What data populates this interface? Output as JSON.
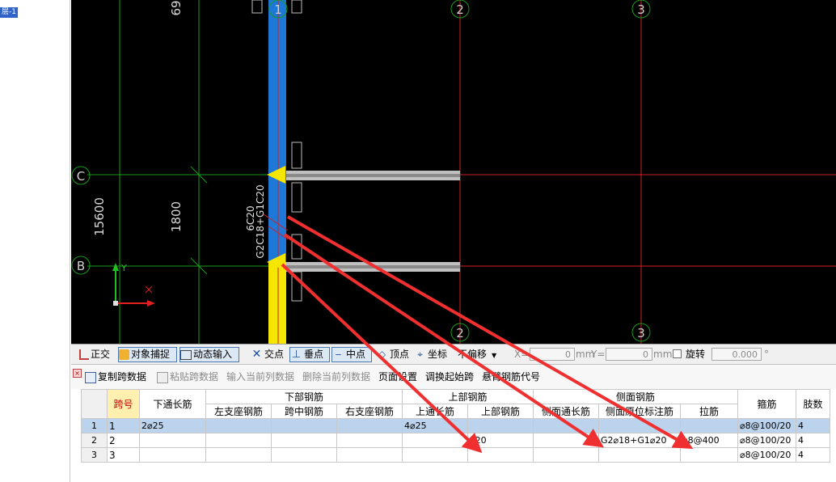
{
  "left_panel": {
    "tree_node": "层-1"
  },
  "canvas": {
    "axis_top": [
      "1",
      "2",
      "3"
    ],
    "axis_bottom": [
      "2",
      "3"
    ],
    "axis_left": [
      "C",
      "B"
    ],
    "dim_top": "69",
    "dim_total": "15600",
    "dim_span": "1800",
    "beam_label_1": "6C20",
    "beam_label_2": "G2C18+G1C20",
    "coord_y": "Y"
  },
  "toolbar": {
    "ortho": "正交",
    "snap": "对象捕捉",
    "dynamic_input": "动态输入",
    "intersection": "交点",
    "perpendicular": "垂点",
    "midpoint": "中点",
    "vertex": "顶点",
    "coordinate": "坐标",
    "no_offset": "不偏移",
    "x_label": "X=",
    "x_value": "0",
    "mm1": "mm",
    "y_label": "Y=",
    "y_value": "0",
    "mm2": "mm",
    "rotate": "旋转",
    "rotate_value": "0.000"
  },
  "panel": {
    "copy_span": "复制跨数据",
    "paste_span": "粘贴跨数据",
    "input_col": "输入当前列数据",
    "delete_col": "删除当前列数据",
    "page_setup": "页面设置",
    "swap_start": "调换起始跨",
    "cantilever": "悬臂钢筋代号"
  },
  "table": {
    "headers": {
      "span_no": "跨号",
      "bottom_through": "下通长筋",
      "bottom_group": "下部钢筋",
      "left_support": "左支座钢筋",
      "mid_span": "跨中钢筋",
      "right_support": "右支座钢筋",
      "top_group": "上部钢筋",
      "top_through": "上通长筋",
      "top_rebar": "上部钢筋",
      "side_group": "侧面钢筋",
      "side_through": "侧面通长筋",
      "side_original": "侧面原位标注筋",
      "tie": "拉筋",
      "stirrup": "箍筋",
      "legs": "肢数"
    },
    "rows": [
      {
        "idx": "1",
        "span": "1",
        "bottom_through": "2⌀25",
        "left": "",
        "mid": "",
        "right": "",
        "top_through": "4⌀25",
        "top_rebar": "",
        "side_through": "",
        "side_original": "",
        "tie": "",
        "stirrup": "⌀8@100/20",
        "legs": "4"
      },
      {
        "idx": "2",
        "span": "2",
        "bottom_through": "",
        "left": "",
        "mid": "",
        "right": "",
        "top_through": "",
        "top_rebar": "⌀20",
        "side_through": "",
        "side_original": "G2⌀18+G1⌀20",
        "tie": "⌀8@400",
        "stirrup": "⌀8@100/20",
        "legs": "4"
      },
      {
        "idx": "3",
        "span": "3",
        "bottom_through": "",
        "left": "",
        "mid": "",
        "right": "",
        "top_through": "",
        "top_rebar": "",
        "side_through": "",
        "side_original": "",
        "tie": "",
        "stirrup": "⌀8@100/20",
        "legs": "4"
      }
    ]
  },
  "colors": {
    "canvas_bg": "#000000",
    "grid_red": "#d42020",
    "grid_green": "#1a9a1a",
    "column_blue": "#1e78d8",
    "column_yellow": "#f5e600",
    "arrow_red": "#f03030",
    "selection": "#bcd3ee"
  }
}
